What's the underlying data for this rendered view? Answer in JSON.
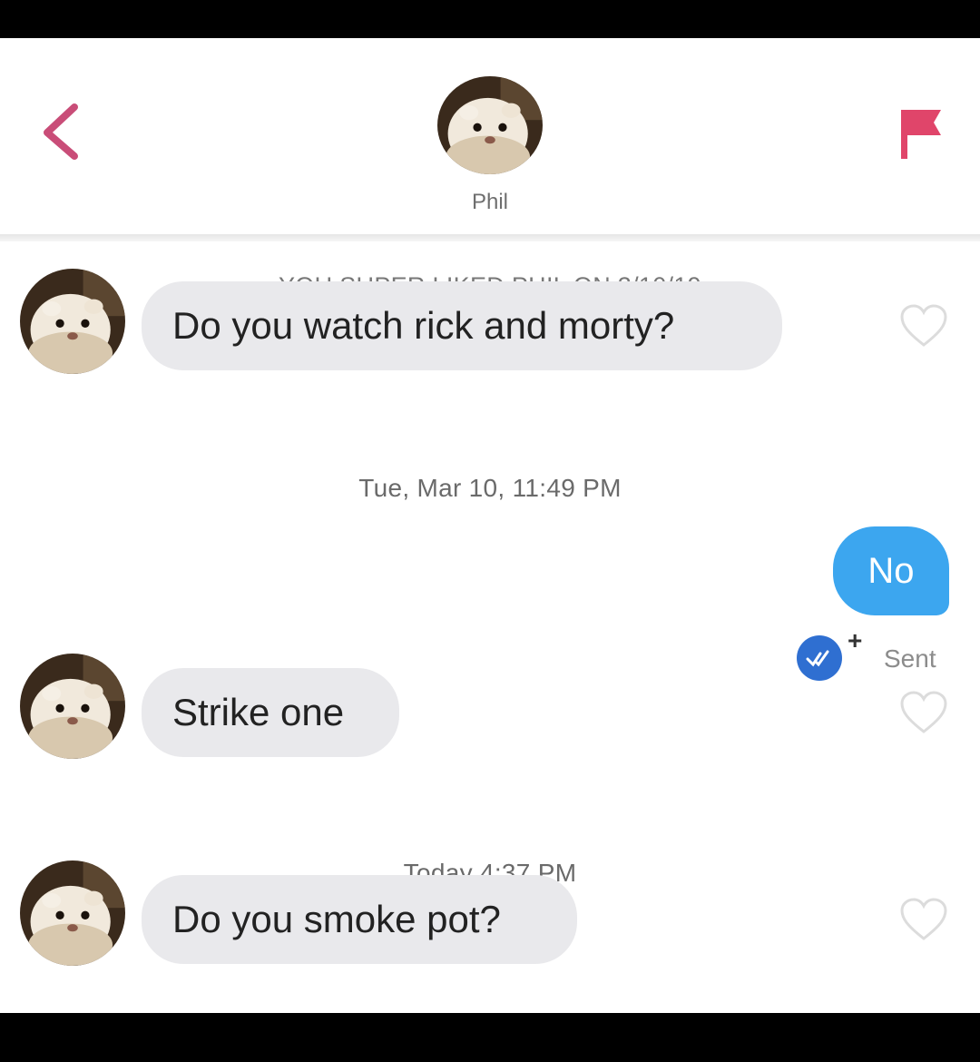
{
  "header": {
    "contact_name": "Phil"
  },
  "notices": {
    "superlike": "YOU SUPER LIKED PHIL ON 3/10/19",
    "timestamp_1": "Tue, Mar 10, 11:49 PM",
    "timestamp_2": "Today 4:37 PM"
  },
  "messages": [
    {
      "from": "Phil",
      "text": "Do you watch rick and morty?"
    },
    {
      "from": "me",
      "text": "No",
      "status": "Sent"
    },
    {
      "from": "Phil",
      "text": "Strike one"
    },
    {
      "from": "Phil",
      "text": "Do you smoke pot?"
    }
  ],
  "colors": {
    "accent_pink": "#e0456a",
    "outgoing_bubble": "#3ca6ef",
    "incoming_bubble": "#e9e9ec",
    "read_badge": "#2f6fd1"
  }
}
